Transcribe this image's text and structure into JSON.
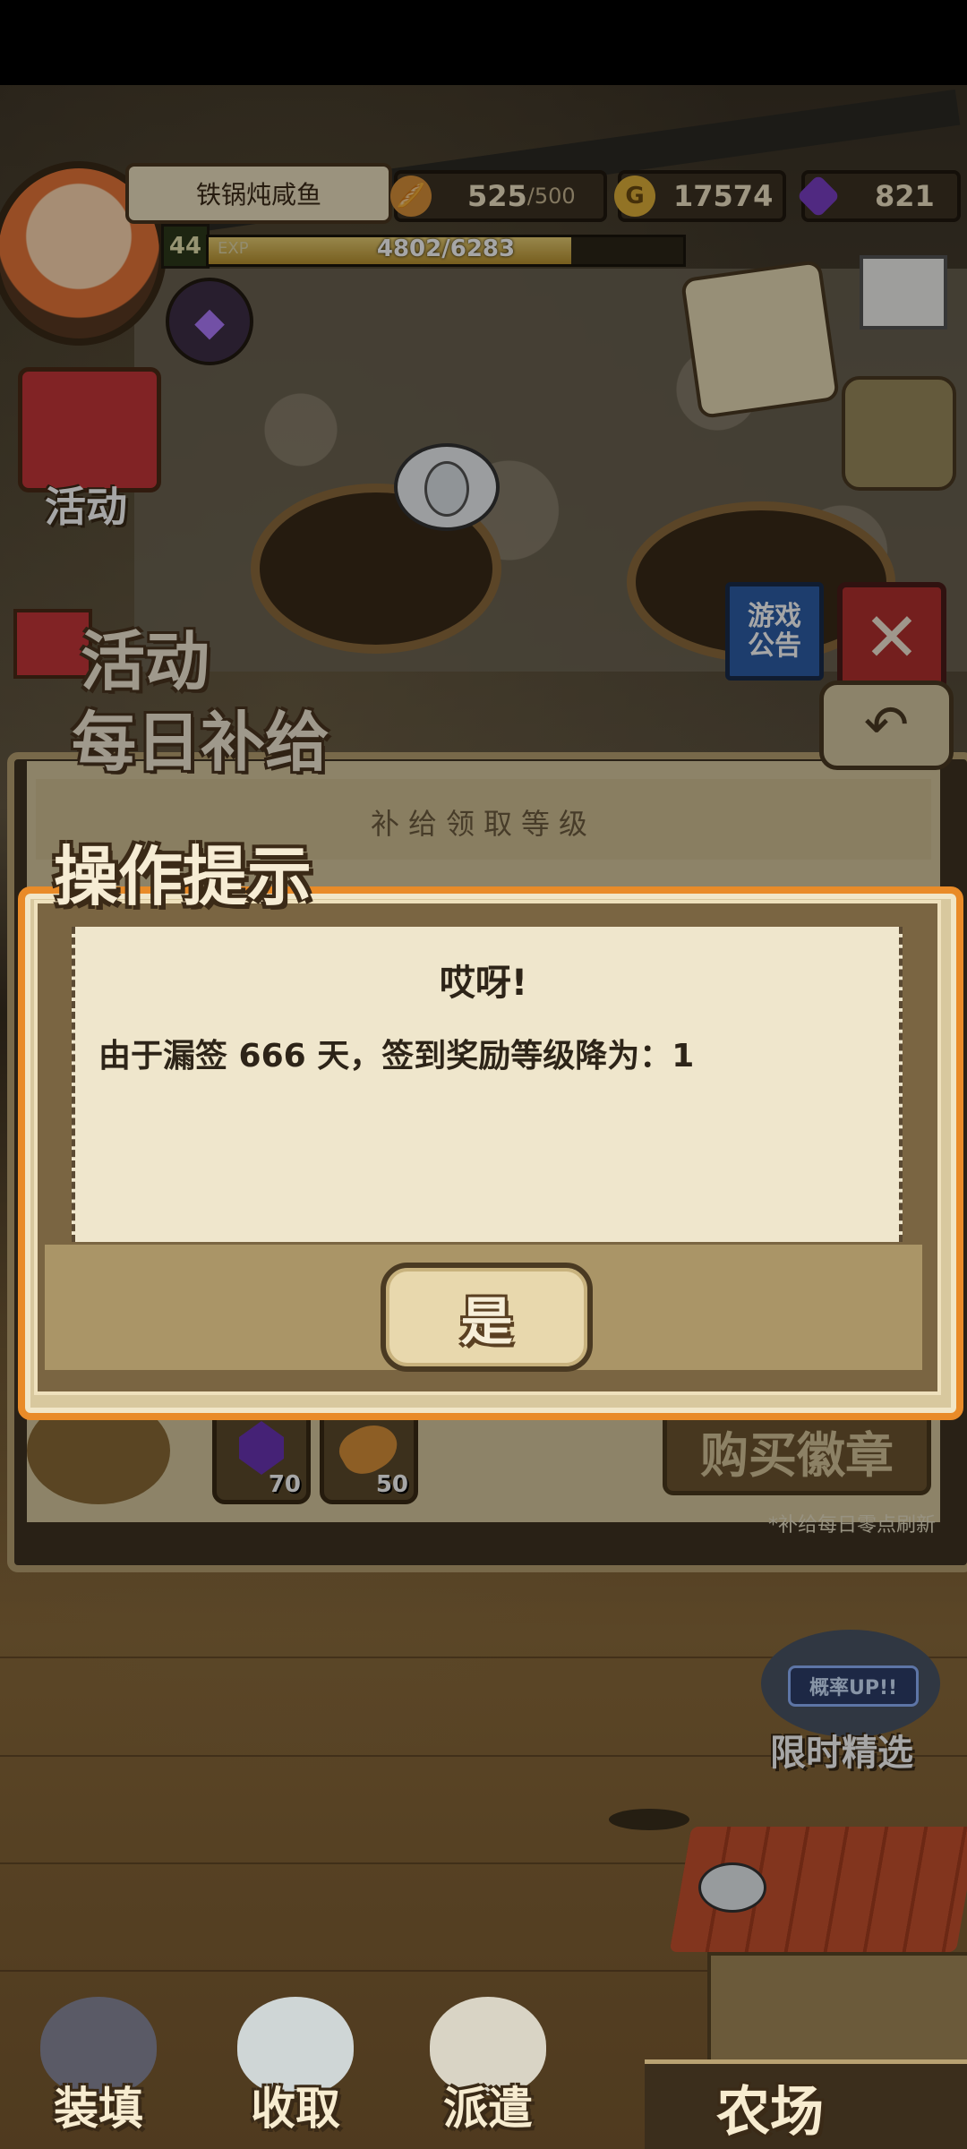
{
  "hud": {
    "player_name": "铁锅炖咸鱼",
    "level": "44",
    "exp_tag": "EXP",
    "exp_text": "4802/6283",
    "exp_progress": 0.764,
    "bread": {
      "value": "525",
      "max": "/500"
    },
    "gold": {
      "value": "17574",
      "icon": "G"
    },
    "gem": {
      "value": "821"
    }
  },
  "side": {
    "activity_label": "活动",
    "announce_label": "游戏公告"
  },
  "panel": {
    "title1": "活动",
    "title2": "每日补给",
    "level_strip": "补给领取等级",
    "items": [
      {
        "icon": "gem-icon",
        "count": "70"
      },
      {
        "icon": "bread-icon",
        "count": "50"
      }
    ],
    "buy_badge": "购买徽章",
    "refresh_note": "*补给每日零点刷新"
  },
  "dialog": {
    "title": "操作提示",
    "heading": "哎呀!",
    "message": "由于漏签 666 天，签到奖励等级降为：1",
    "confirm": "是"
  },
  "limited": {
    "label": "限时精选",
    "badge": "概率UP!!"
  },
  "nav": {
    "load": "装填",
    "collect": "收取",
    "dispatch": "派遣",
    "farm": "农场"
  },
  "colors": {
    "dialog_border": "#e98b28",
    "paper": "#efe6cc",
    "title_shadow": "#3b2a17"
  }
}
